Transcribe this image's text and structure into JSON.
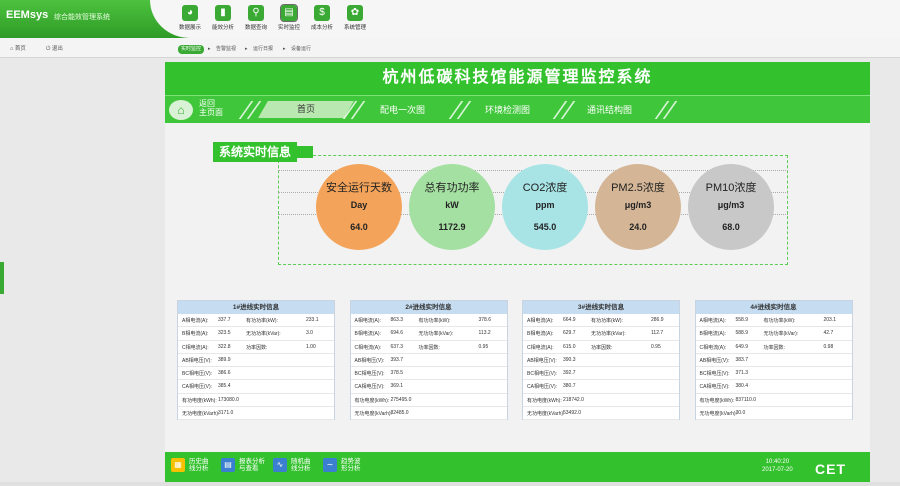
{
  "app": {
    "logo": "EEMsys",
    "subtitle": "综合能效管理系统"
  },
  "topnav": [
    {
      "label": "数据展示",
      "icon": "pie-chart-icon",
      "glyph": "◕"
    },
    {
      "label": "能效分析",
      "icon": "bar-chart-icon",
      "glyph": "▮"
    },
    {
      "label": "数据查询",
      "icon": "search-icon",
      "glyph": "⚲"
    },
    {
      "label": "实时监控",
      "icon": "monitor-icon",
      "glyph": "▤"
    },
    {
      "label": "成本分析",
      "icon": "money-icon",
      "glyph": "$"
    },
    {
      "label": "系统管理",
      "icon": "gear-icon",
      "glyph": "✿"
    }
  ],
  "row2": {
    "home": "首页",
    "logout": "退出"
  },
  "subtabs": [
    {
      "label": "实时监控"
    },
    {
      "label": "告警监视"
    },
    {
      "label": "运行日报"
    },
    {
      "label": "设备运行"
    }
  ],
  "panel": {
    "title": "杭州低碳科技馆能源管理监控系统",
    "back": [
      "返回",
      "主页面"
    ],
    "nav": [
      "首页",
      "配电一次图",
      "环境检测图",
      "通讯结构图"
    ],
    "realtime_title": "系统实时信息",
    "circles": [
      {
        "name": "安全运行天数",
        "unit": "Day",
        "value": "64.0",
        "color": "#f4a45a"
      },
      {
        "name": "总有功功率",
        "unit": "kW",
        "value": "1172.9",
        "color": "#a4e0a2"
      },
      {
        "name": "CO2浓度",
        "unit": "ppm",
        "value": "545.0",
        "color": "#a8e4e6"
      },
      {
        "name": "PM2.5浓度",
        "unit": "μg/m3",
        "value": "24.0",
        "color": "#d4b697"
      },
      {
        "name": "PM10浓度",
        "unit": "μg/m3",
        "value": "68.0",
        "color": "#c8c8c8"
      }
    ],
    "cards": [
      {
        "title": "1#进线实时信息",
        "rows": [
          [
            "A相电流(A):",
            "337.7",
            "有功功率(kW):",
            "233.1"
          ],
          [
            "B相电流(A):",
            "323.5",
            "无功功率(kVar):",
            "3.0"
          ],
          [
            "C相电流(A):",
            "322.8",
            "功率因数:",
            "1.00"
          ],
          [
            "AB相电压(V):",
            "389.9",
            "",
            ""
          ],
          [
            "BC相电压(V):",
            "386.6",
            "",
            ""
          ],
          [
            "CA相电压(V):",
            "385.4",
            "",
            ""
          ],
          [
            "有功电度(kWh):",
            "173080.0",
            "",
            ""
          ],
          [
            "无功电度(kVarh):",
            "3171.0",
            "",
            ""
          ]
        ]
      },
      {
        "title": "2#进线实时信息",
        "rows": [
          [
            "A相电流(A):",
            "863.3",
            "有功功率(kW):",
            "378.6"
          ],
          [
            "B相电流(A):",
            "694.6",
            "无功功率(kVar):",
            "113.2"
          ],
          [
            "C相电流(A):",
            "637.3",
            "功率因数:",
            "0.95"
          ],
          [
            "AB相电压(V):",
            "393.7",
            "",
            ""
          ],
          [
            "BC相电压(V):",
            "378.5",
            "",
            ""
          ],
          [
            "CA相电压(V):",
            "369.1",
            "",
            ""
          ],
          [
            "有功电度(kWh):",
            "275495.0",
            "",
            ""
          ],
          [
            "无功电度(kVarh):",
            "82485.0",
            "",
            ""
          ]
        ]
      },
      {
        "title": "3#进线实时信息",
        "rows": [
          [
            "A相电流(A):",
            "664.9",
            "有功功率(kW):",
            "286.9"
          ],
          [
            "B相电流(A):",
            "629.7",
            "无功功率(kVar):",
            "112.7"
          ],
          [
            "C相电流(A):",
            "615.0",
            "功率因数:",
            "0.95"
          ],
          [
            "AB相电压(V):",
            "390.3",
            "",
            ""
          ],
          [
            "BC相电压(V):",
            "392.7",
            "",
            ""
          ],
          [
            "CA相电压(V):",
            "380.7",
            "",
            ""
          ],
          [
            "有功电度(kWh):",
            "218742.0",
            "",
            ""
          ],
          [
            "无功电度(kVarh):",
            "53492.0",
            "",
            ""
          ]
        ]
      },
      {
        "title": "4#进线实时信息",
        "rows": [
          [
            "A相电流(A):",
            "558.9",
            "有功功率(kW):",
            "203.1"
          ],
          [
            "B相电流(A):",
            "588.9",
            "无功功率(kVar):",
            "42.7"
          ],
          [
            "C相电流(A):",
            "649.9",
            "功率因数:",
            "0.98"
          ],
          [
            "AB相电压(V):",
            "383.7",
            "",
            ""
          ],
          [
            "BC相电压(V):",
            "371.3",
            "",
            ""
          ],
          [
            "CA相电压(V):",
            "380.4",
            "",
            ""
          ],
          [
            "有功电度(kWh):",
            "837110.0",
            "",
            ""
          ],
          [
            "无功电度(kVarh):",
            "30.0",
            "",
            ""
          ]
        ]
      }
    ],
    "bottom": [
      {
        "label": [
          "历史曲",
          "线分析"
        ],
        "icon": "history-chart-icon",
        "glyph": "▦",
        "color": "#f5c000"
      },
      {
        "label": [
          "报表分析",
          "与查看"
        ],
        "icon": "report-icon",
        "glyph": "▤",
        "color": "#3a7fd0"
      },
      {
        "label": [
          "随机曲",
          "线分析"
        ],
        "icon": "curve-chart-icon",
        "glyph": "∿",
        "color": "#3a7fd0"
      },
      {
        "label": [
          "趋势波",
          "形分析"
        ],
        "icon": "wave-icon",
        "glyph": "∼",
        "color": "#3a7fd0"
      }
    ],
    "clock": {
      "time": "10:40:20",
      "date": "2017-07-20"
    },
    "brand": "CET"
  }
}
